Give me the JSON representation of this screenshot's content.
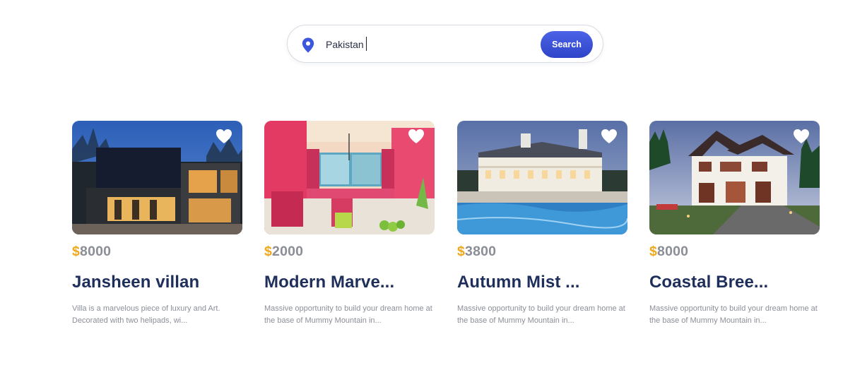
{
  "search": {
    "value": "Pakistan",
    "button_label": "Search",
    "icon": "location-pin-icon"
  },
  "colors": {
    "accent": "#3a52d9",
    "price_currency": "#f2a81d",
    "title": "#1f2f5c"
  },
  "listings": [
    {
      "currency": "$",
      "price": "8000",
      "title": "Jansheen villan",
      "description": "Villa is a marvelous piece of luxury and Art. Decorated with two helipads, wi...",
      "favorite_icon": "heart-icon"
    },
    {
      "currency": "$",
      "price": "2000",
      "title": "Modern Marve...",
      "description": "Massive opportunity to build your dream home at the base of Mummy Mountain in...",
      "favorite_icon": "heart-icon"
    },
    {
      "currency": "$",
      "price": "3800",
      "title": "Autumn Mist ...",
      "description": "Massive opportunity to build your dream home at the base of Mummy Mountain in...",
      "favorite_icon": "heart-icon"
    },
    {
      "currency": "$",
      "price": "8000",
      "title": "Coastal Bree...",
      "description": "Massive opportunity to build your dream home at the base of Mummy Mountain in...",
      "favorite_icon": "heart-icon"
    }
  ]
}
